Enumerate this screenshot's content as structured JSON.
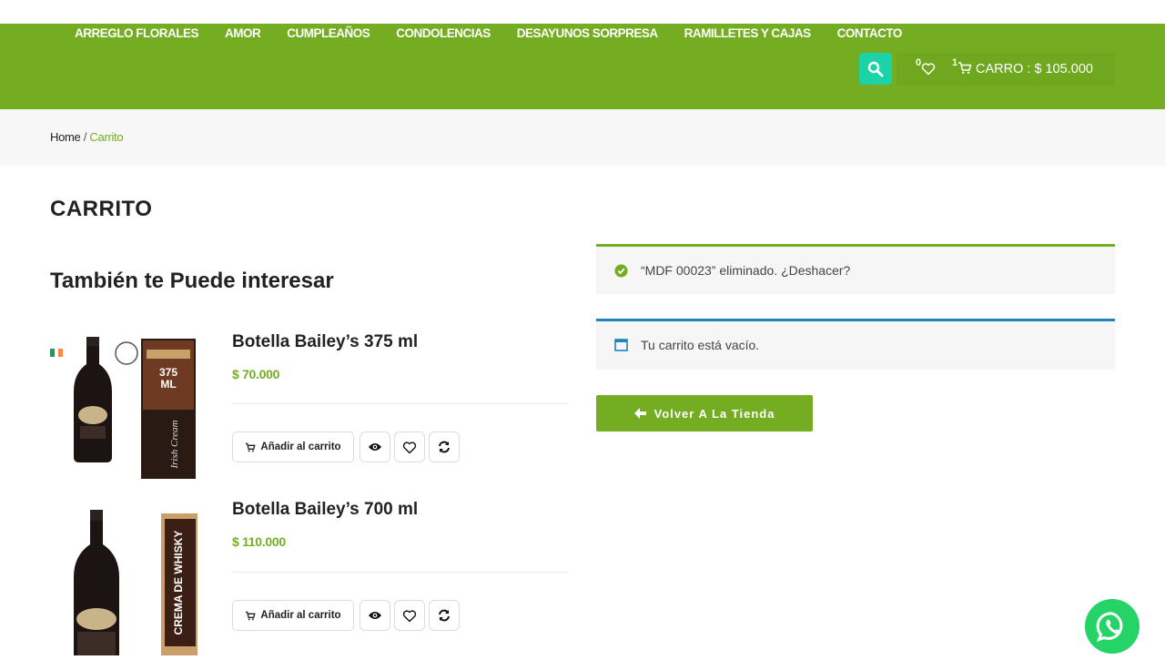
{
  "nav": {
    "items": [
      "ARREGLO FLORALES",
      "AMOR",
      "CUMPLEAÑOS",
      "CONDOLENCIAS",
      "DESAYUNOS SORPRESA",
      "RAMILLETES Y CAJAS",
      "CONTACTO"
    ]
  },
  "header": {
    "wishlist_count": "0",
    "cart_count": "1",
    "cart_label": "CARRO : $ 105.000"
  },
  "breadcrumb": {
    "home": "Home",
    "separator": " / ",
    "current": "Carrito"
  },
  "page": {
    "title": "CARRITO",
    "related_title": "También te Puede interesar"
  },
  "products": [
    {
      "name": "Botella Bailey’s 375 ml",
      "price": "$ 70.000",
      "add_label": "Añadir al carrito",
      "badge": "375 ML",
      "side_text": "Irish Cream"
    },
    {
      "name": "Botella Bailey’s 700 ml",
      "price": "$ 110.000",
      "add_label": "Añadir al carrito",
      "badge": "CREMA DE WHISKY"
    }
  ],
  "notices": {
    "removed": "“MDF 00023” eliminado.",
    "undo": "¿Deshacer?",
    "empty": "Tu carrito está vacío."
  },
  "back_button": "Volver A La Tienda",
  "colors": {
    "brand_green": "#74ad22",
    "accent_teal": "#1bd3a6",
    "info_blue": "#1e85be",
    "whatsapp": "#25d366"
  }
}
